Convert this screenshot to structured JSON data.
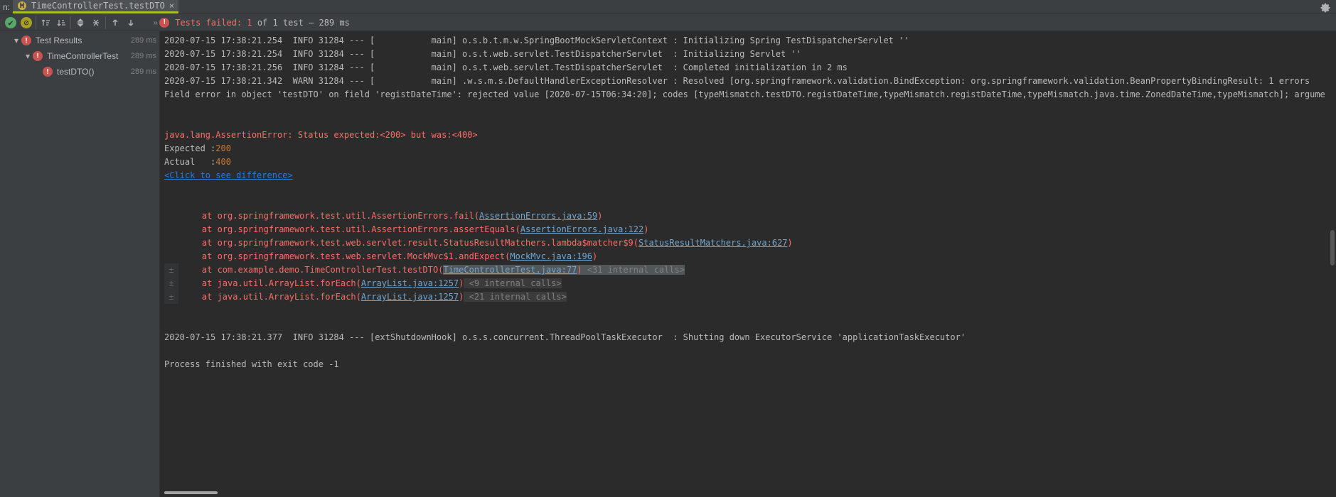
{
  "header": {
    "pre_n": "n:",
    "tab_label": "TimeControllerTest.testDTO"
  },
  "toolbar": {
    "status_fail": "Tests failed: 1",
    "status_rest": " of 1 test – 289 ms",
    "chev": "»"
  },
  "tree": {
    "root": {
      "label": "Test Results",
      "time": "289 ms"
    },
    "suite": {
      "label": "TimeControllerTest",
      "time": "289 ms"
    },
    "test": {
      "label": "testDTO()",
      "time": "289 ms"
    }
  },
  "log": {
    "l1": "2020-07-15 17:38:21.254  INFO 31284 --- [           main] o.s.b.t.m.w.SpringBootMockServletContext : Initializing Spring TestDispatcherServlet ''",
    "l2": "2020-07-15 17:38:21.254  INFO 31284 --- [           main] o.s.t.web.servlet.TestDispatcherServlet  : Initializing Servlet ''",
    "l3": "2020-07-15 17:38:21.256  INFO 31284 --- [           main] o.s.t.web.servlet.TestDispatcherServlet  : Completed initialization in 2 ms",
    "l4": "2020-07-15 17:38:21.342  WARN 31284 --- [           main] .w.s.m.s.DefaultHandlerExceptionResolver : Resolved [org.springframework.validation.BindException: org.springframework.validation.BeanPropertyBindingResult: 1 errors",
    "l5": "Field error in object 'testDTO' on field 'registDateTime': rejected value [2020-07-15T06:34:20]; codes [typeMismatch.testDTO.registDateTime,typeMismatch.registDateTime,typeMismatch.java.time.ZonedDateTime,typeMismatch]; argume",
    "asserr": "java.lang.AssertionError: Status expected:<200> but was:<400>",
    "exp_l": "Expected :",
    "exp_v": "200",
    "act_l": "Actual   :",
    "act_v": "400",
    "diff": "<Click to see difference>",
    "st1_a": "    at org.springframework.test.util.AssertionErrors.fail(",
    "st1_l": "AssertionErrors.java:59",
    "st1_e": ")",
    "st2_a": "    at org.springframework.test.util.AssertionErrors.assertEquals(",
    "st2_l": "AssertionErrors.java:122",
    "st2_e": ")",
    "st3_a": "    at org.springframework.test.web.servlet.result.StatusResultMatchers.lambda$matcher$9(",
    "st3_l": "StatusResultMatchers.java:627",
    "st3_e": ")",
    "st4_a": "    at org.springframework.test.web.servlet.MockMvc$1.andExpect(",
    "st4_l": "MockMvc.java:196",
    "st4_e": ")",
    "st5_a": "    at com.example.demo.TimeControllerTest.testDTO(",
    "st5_l": "TimeControllerTest.java:77",
    "st5_e": ")",
    "st5_i": " <31 internal calls>",
    "st6_a": "    at java.util.ArrayList.forEach(",
    "st6_l": "ArrayList.java:1257",
    "st6_e": ")",
    "st6_i": " <9 internal calls>",
    "st7_a": "    at java.util.ArrayList.forEach(",
    "st7_l": "ArrayList.java:1257",
    "st7_e": ")",
    "st7_i": " <21 internal calls>",
    "shut": "2020-07-15 17:38:21.377  INFO 31284 --- [extShutdownHook] o.s.s.concurrent.ThreadPoolTaskExecutor  : Shutting down ExecutorService 'applicationTaskExecutor'",
    "exit": "Process finished with exit code -1",
    "gutp": "±"
  }
}
